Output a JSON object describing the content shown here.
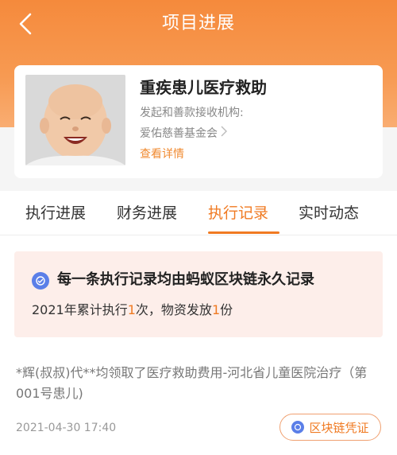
{
  "nav": {
    "title": "项目进展"
  },
  "project": {
    "title": "重疾患儿医疗救助",
    "subtitle": "发起和善款接收机构:",
    "org": "爱佑慈善基金会",
    "detail_link": "查看详情",
    "avatar_icon": "child-photo"
  },
  "tabs": [
    {
      "label": "执行进展",
      "active": false
    },
    {
      "label": "财务进展",
      "active": false
    },
    {
      "label": "执行记录",
      "active": true
    },
    {
      "label": "实时动态",
      "active": false
    }
  ],
  "notice": {
    "icon": "blockchain-icon",
    "title": "每一条执行记录均由蚂蚁区块链永久记录",
    "line_prefix": "2021年累计执行",
    "exec_count": "1",
    "line_mid": "次，物资发放",
    "supply_count": "1",
    "line_suffix": "份"
  },
  "record": {
    "text": "*辉(叔叔)代**均领取了医疗救助费用-河北省儿童医院治疗（第001号患儿)",
    "time": "2021-04-30 17:40",
    "chain_button": "区块链凭证"
  },
  "colors": {
    "accent": "#f07a22",
    "header": "#f58a3c",
    "notice_bg": "#fdeeea",
    "chain_icon": "#5b7fe8"
  }
}
